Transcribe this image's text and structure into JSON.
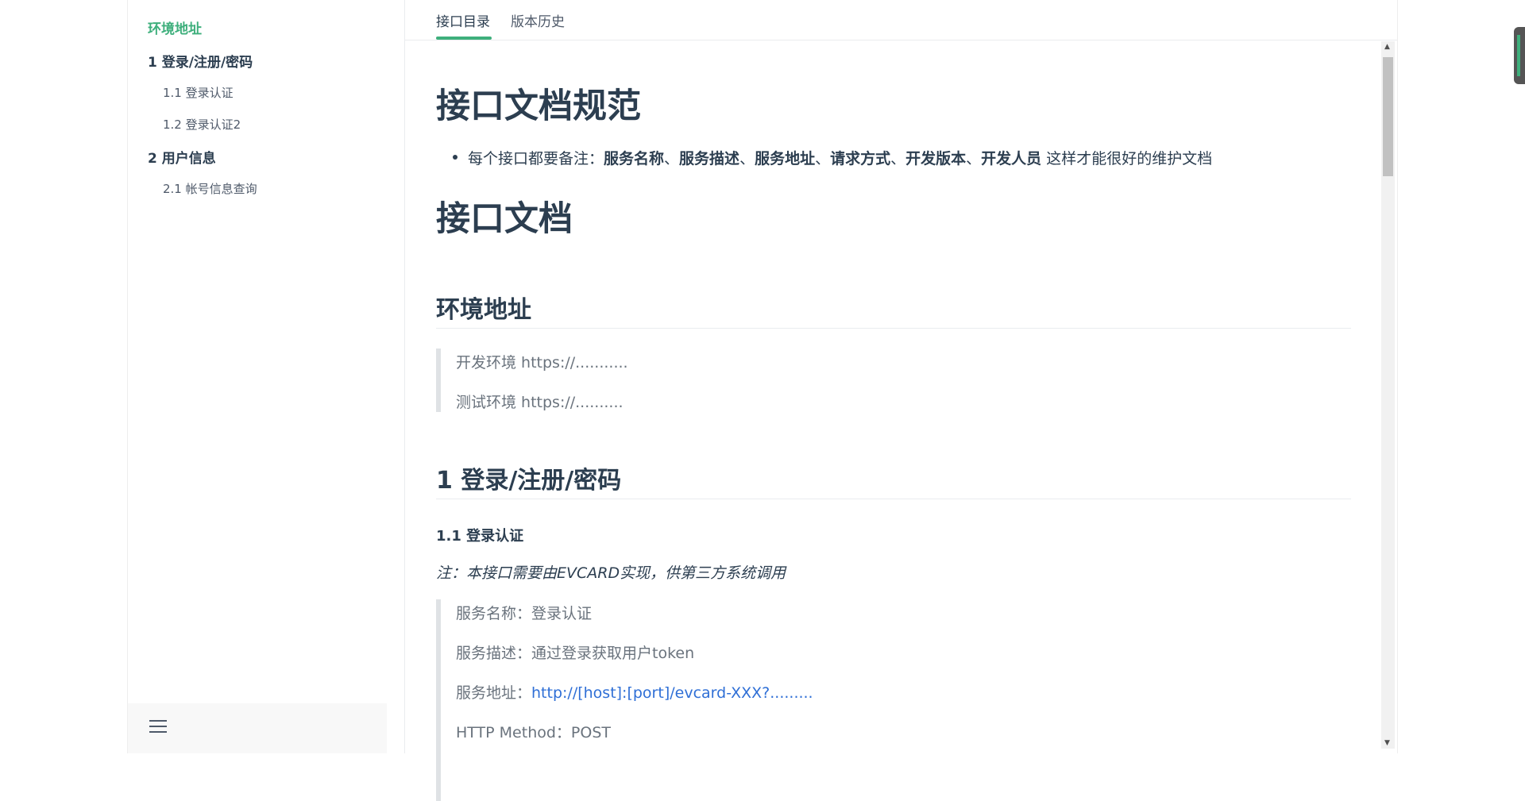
{
  "sidebar": {
    "items": [
      {
        "label": "环境地址",
        "level": 1,
        "active": true
      },
      {
        "label": "1 登录/注册/密码",
        "level": 1,
        "active": false
      },
      {
        "label": "1.1 登录认证",
        "level": 2,
        "active": false
      },
      {
        "label": "1.2 登录认证2",
        "level": 2,
        "active": false
      },
      {
        "label": "2 用户信息",
        "level": 1,
        "active": false
      },
      {
        "label": "2.1 帐号信息查询",
        "level": 2,
        "active": false
      }
    ],
    "menu_icon": "hamburger-menu-icon"
  },
  "tabs": [
    {
      "label": "接口目录",
      "active": true
    },
    {
      "label": "版本历史",
      "active": false
    }
  ],
  "doc": {
    "title1": "接口文档规范",
    "bullet": {
      "prefix": "每个接口都要备注：",
      "items": [
        "服务名称",
        "服务描述",
        "服务地址",
        "请求方式",
        "开发版本",
        "开发人员"
      ],
      "separator": "、",
      "suffix": " 这样才能很好的维护文档"
    },
    "title2": "接口文档",
    "env_heading": "环境地址",
    "env_lines": [
      "开发环境 https://...........",
      "测试环境 https://.........."
    ],
    "section1_heading": "1 登录/注册/密码",
    "sub1_heading": "1.1 登录认证",
    "note": "注：本接口需要由EVCARD实现，供第三方系统调用",
    "service": {
      "name_label": "服务名称：",
      "name_value": "登录认证",
      "desc_label": "服务描述：",
      "desc_value": "通过登录获取用户token",
      "addr_label": "服务地址：",
      "addr_value": "http://[host]:[port]/evcard-XXX?.........",
      "method_label": "HTTP Method：",
      "method_value": "POST"
    }
  },
  "colors": {
    "accent": "#3eaf7c",
    "link": "#2f6fd6",
    "text": "#2c3e50",
    "quote_text": "#6a737d"
  }
}
